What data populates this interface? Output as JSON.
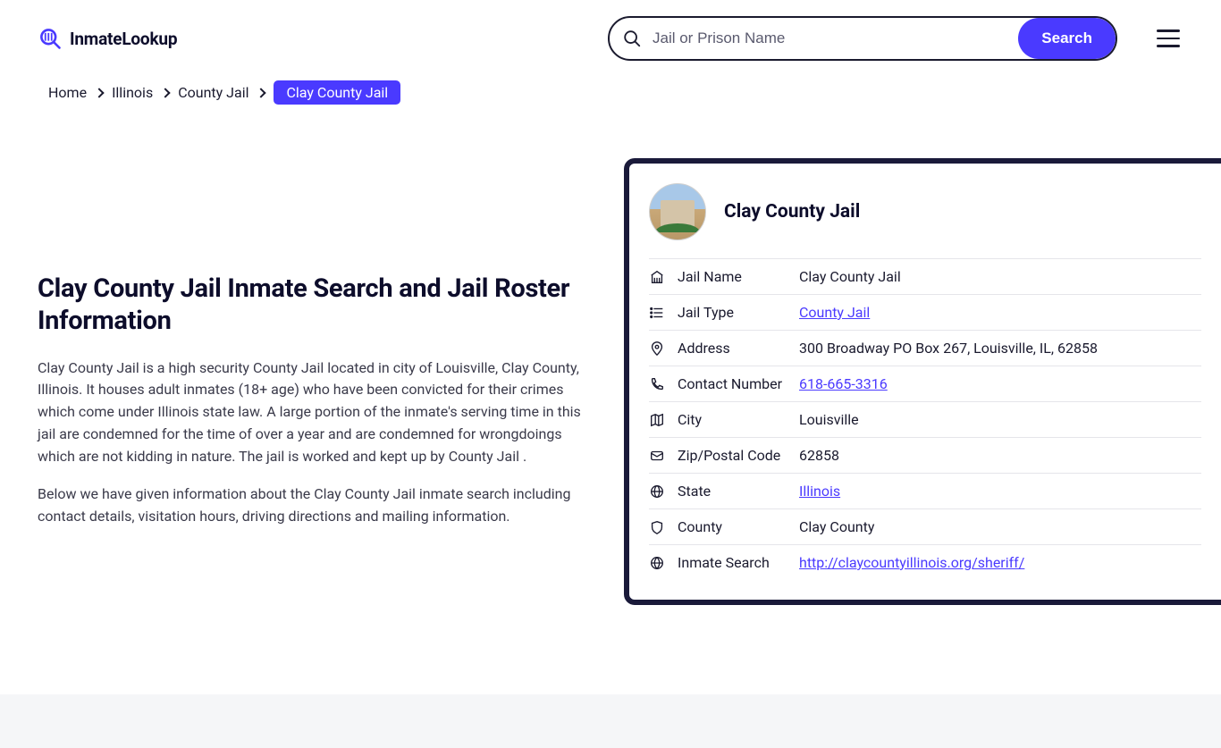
{
  "logo": {
    "text": "InmateLookup"
  },
  "search": {
    "placeholder": "Jail or Prison Name",
    "button": "Search"
  },
  "breadcrumbs": {
    "items": [
      "Home",
      "Illinois",
      "County Jail"
    ],
    "current": "Clay County Jail"
  },
  "page": {
    "title": "Clay County Jail Inmate Search and Jail Roster Information",
    "p1": "Clay County Jail is a high security County Jail located in city of Louisville, Clay County, Illinois. It houses adult inmates (18+ age) who have been convicted for their crimes which come under Illinois state law. A large portion of the inmate's serving time in this jail are condemned for the time of over a year and are condemned for wrongdoings which are not kidding in nature. The jail is worked and kept up by County Jail .",
    "p2": "Below we have given information about the Clay County Jail inmate search including contact details, visitation hours, driving directions and mailing information."
  },
  "card": {
    "title": "Clay County Jail",
    "rows": [
      {
        "label": "Jail Name",
        "value": "Clay County Jail",
        "link": false,
        "icon": "building"
      },
      {
        "label": "Jail Type",
        "value": "County Jail",
        "link": true,
        "icon": "list"
      },
      {
        "label": "Address",
        "value": "300 Broadway PO Box 267, Louisville, IL, 62858",
        "link": false,
        "icon": "pin"
      },
      {
        "label": "Contact Number",
        "value": "618-665-3316",
        "link": true,
        "icon": "phone"
      },
      {
        "label": "City",
        "value": "Louisville",
        "link": false,
        "icon": "map"
      },
      {
        "label": "Zip/Postal Code",
        "value": "62858",
        "link": false,
        "icon": "envelope"
      },
      {
        "label": "State",
        "value": "Illinois",
        "link": true,
        "icon": "globe"
      },
      {
        "label": "County",
        "value": "Clay County",
        "link": false,
        "icon": "shield"
      },
      {
        "label": "Inmate Search",
        "value": "http://claycountyillinois.org/sheriff/",
        "link": true,
        "icon": "web"
      }
    ]
  }
}
